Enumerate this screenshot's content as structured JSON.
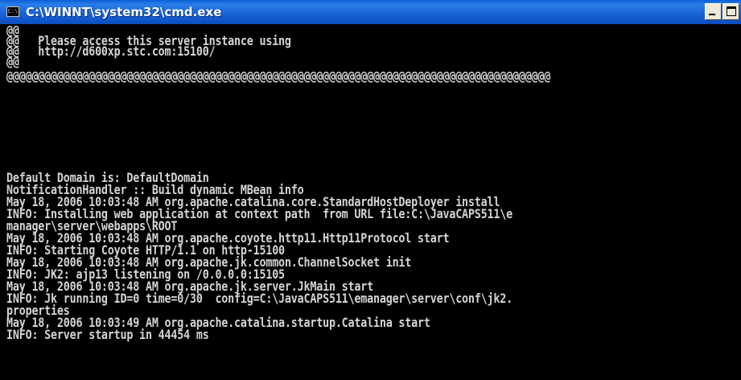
{
  "window": {
    "title": "C:\\WINNT\\system32\\cmd.exe",
    "icon_label": "C:\\",
    "icon": "console-app-icon"
  },
  "colors": {
    "titlebar": "#1a63d6",
    "console_background": "#000000",
    "console_text": "#d4d4d4"
  },
  "console": {
    "lines": [
      "@@",
      "@@   Please access this server instance using",
      "@@   http://d600xp.stc.com:15100/",
      "@@",
      "@@@@@@@@@@@@@@@@@@@@@@@@@@@@@@@@@@@@@@@@@@@@@@@@@@@@@@@@@@@@@@@@@@@@@@@@@@@@@@@@@@@@@@",
      "",
      "",
      "",
      "",
      "",
      "Default Domain is: DefaultDomain",
      "NotificationHandler :: Build dynamic MBean info",
      "May 18, 2006 10:03:48 AM org.apache.catalina.core.StandardHostDeployer install",
      "INFO: Installing web application at context path  from URL file:C:\\JavaCAPS511\\e",
      "manager\\server\\webapps\\ROOT",
      "May 18, 2006 10:03:48 AM org.apache.coyote.http11.Http11Protocol start",
      "INFO: Starting Coyote HTTP/1.1 on http-15100",
      "May 18, 2006 10:03:48 AM org.apache.jk.common.ChannelSocket init",
      "INFO: JK2: ajp13 listening on /0.0.0.0:15105",
      "May 18, 2006 10:03:48 AM org.apache.jk.server.JkMain start",
      "INFO: Jk running ID=0 time=0/30  config=C:\\JavaCAPS511\\emanager\\server\\conf\\jk2.",
      "properties",
      "May 18, 2006 10:03:49 AM org.apache.catalina.startup.Catalina start",
      "INFO: Server startup in 44454 ms"
    ]
  }
}
